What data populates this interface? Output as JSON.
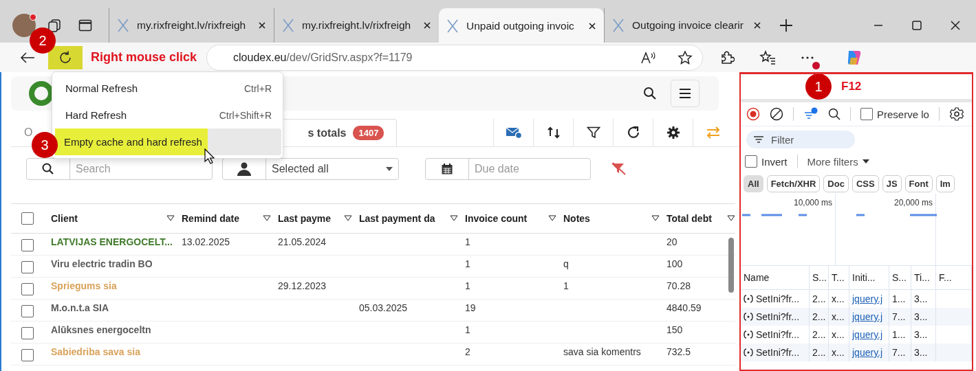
{
  "browser": {
    "tabs": [
      {
        "title": "my.rixfreight.lv/rixfreigh",
        "selected": false
      },
      {
        "title": "my.rixfreight.lv/rixfreigh",
        "selected": false
      },
      {
        "title": "Unpaid outgoing invoic",
        "selected": true
      },
      {
        "title": "Outgoing invoice clearir",
        "selected": false
      }
    ],
    "address": {
      "host": "cloudex.eu",
      "path": "/dev/GridSrv.aspx?f=1179"
    }
  },
  "annotations": {
    "step_1": "1",
    "f12_label": "F12",
    "step_2": "2",
    "right_click_label": "Right mouse click",
    "step_3": "3"
  },
  "reload_menu": {
    "items": [
      {
        "label": "Normal Refresh",
        "shortcut": "Ctrl+R",
        "highlighted": false
      },
      {
        "label": "Hard Refresh",
        "shortcut": "Ctrl+Shift+R",
        "highlighted": false
      },
      {
        "label": "Empty cache and hard refresh",
        "highlighted": true
      }
    ]
  },
  "page": {
    "tabs": [
      {
        "label": "O",
        "selected": false
      },
      {
        "label": "s totals",
        "count": "1407",
        "selected": true
      }
    ],
    "search": {
      "placeholder": "Search"
    },
    "client_filter": {
      "value": "Selected all"
    },
    "due_date": {
      "placeholder": "Due date"
    },
    "table": {
      "select_all_checked": false,
      "columns": [
        "Client",
        "Remind date",
        "Last payme",
        "Last payment da",
        "Invoice count",
        "Notes",
        "Total debt"
      ],
      "rows": [
        {
          "checked": false,
          "color": "#3f7a2a",
          "cells": [
            "LATVIJAS ENERGOCELT...",
            "13.02.2025",
            "21.05.2024",
            "",
            "1",
            "",
            "20"
          ]
        },
        {
          "checked": false,
          "color": "#5a5a5a",
          "cells": [
            "Viru electric tradin BO",
            "",
            "",
            "",
            "1",
            "q",
            "100"
          ]
        },
        {
          "checked": false,
          "color": "#d9a25a",
          "cells": [
            "Spriegums sia",
            "",
            "29.12.2023",
            "",
            "1",
            "1",
            "70.28"
          ]
        },
        {
          "checked": false,
          "color": "#5a5a5a",
          "cells": [
            "M.o.n.t.a SIA",
            "",
            "",
            "05.03.2025",
            "19",
            "",
            "4840.59"
          ]
        },
        {
          "checked": false,
          "color": "#5a5a5a",
          "cells": [
            "Alūksnes energoceltn",
            "",
            "",
            "",
            "1",
            "",
            "150"
          ]
        },
        {
          "checked": false,
          "color": "#d9a25a",
          "cells": [
            "Sabiedriba sava sia",
            "",
            "",
            "",
            "2",
            "sava sia komentrs",
            "732.5"
          ]
        }
      ]
    }
  },
  "devtools": {
    "preserve_log": {
      "label": "Preserve lo",
      "checked": false
    },
    "filter": {
      "placeholder": "Filter"
    },
    "invert": {
      "label": "Invert",
      "checked": false
    },
    "more_filters": "More filters",
    "type_filters": [
      {
        "label": "All",
        "selected": true
      },
      {
        "label": "Fetch/XHR",
        "selected": false
      },
      {
        "label": "Doc",
        "selected": false
      },
      {
        "label": "CSS",
        "selected": false
      },
      {
        "label": "JS",
        "selected": false
      },
      {
        "label": "Font",
        "selected": false
      },
      {
        "label": "Im",
        "selected": false
      }
    ],
    "timeline_ticks": [
      "10,000 ms",
      "20,000 ms"
    ],
    "network_table": {
      "columns": [
        "Name",
        "S...",
        "T...",
        "Initi...",
        "S...",
        "Ti...",
        "F..."
      ],
      "rows": [
        {
          "cells": [
            "SetIni?fr...",
            "2...",
            "x...",
            "jquery.j",
            "1...",
            "3..."
          ]
        },
        {
          "cells": [
            "SetIni?fr...",
            "2...",
            "x...",
            "jquery.j",
            "7...",
            "3..."
          ]
        },
        {
          "cells": [
            "SetIni?fr...",
            "2...",
            "x...",
            "jquery.j",
            "1...",
            "3..."
          ]
        },
        {
          "cells": [
            "SetIni?fr...",
            "2...",
            "x...",
            "jquery.j",
            "7...",
            "3..."
          ]
        }
      ]
    }
  }
}
